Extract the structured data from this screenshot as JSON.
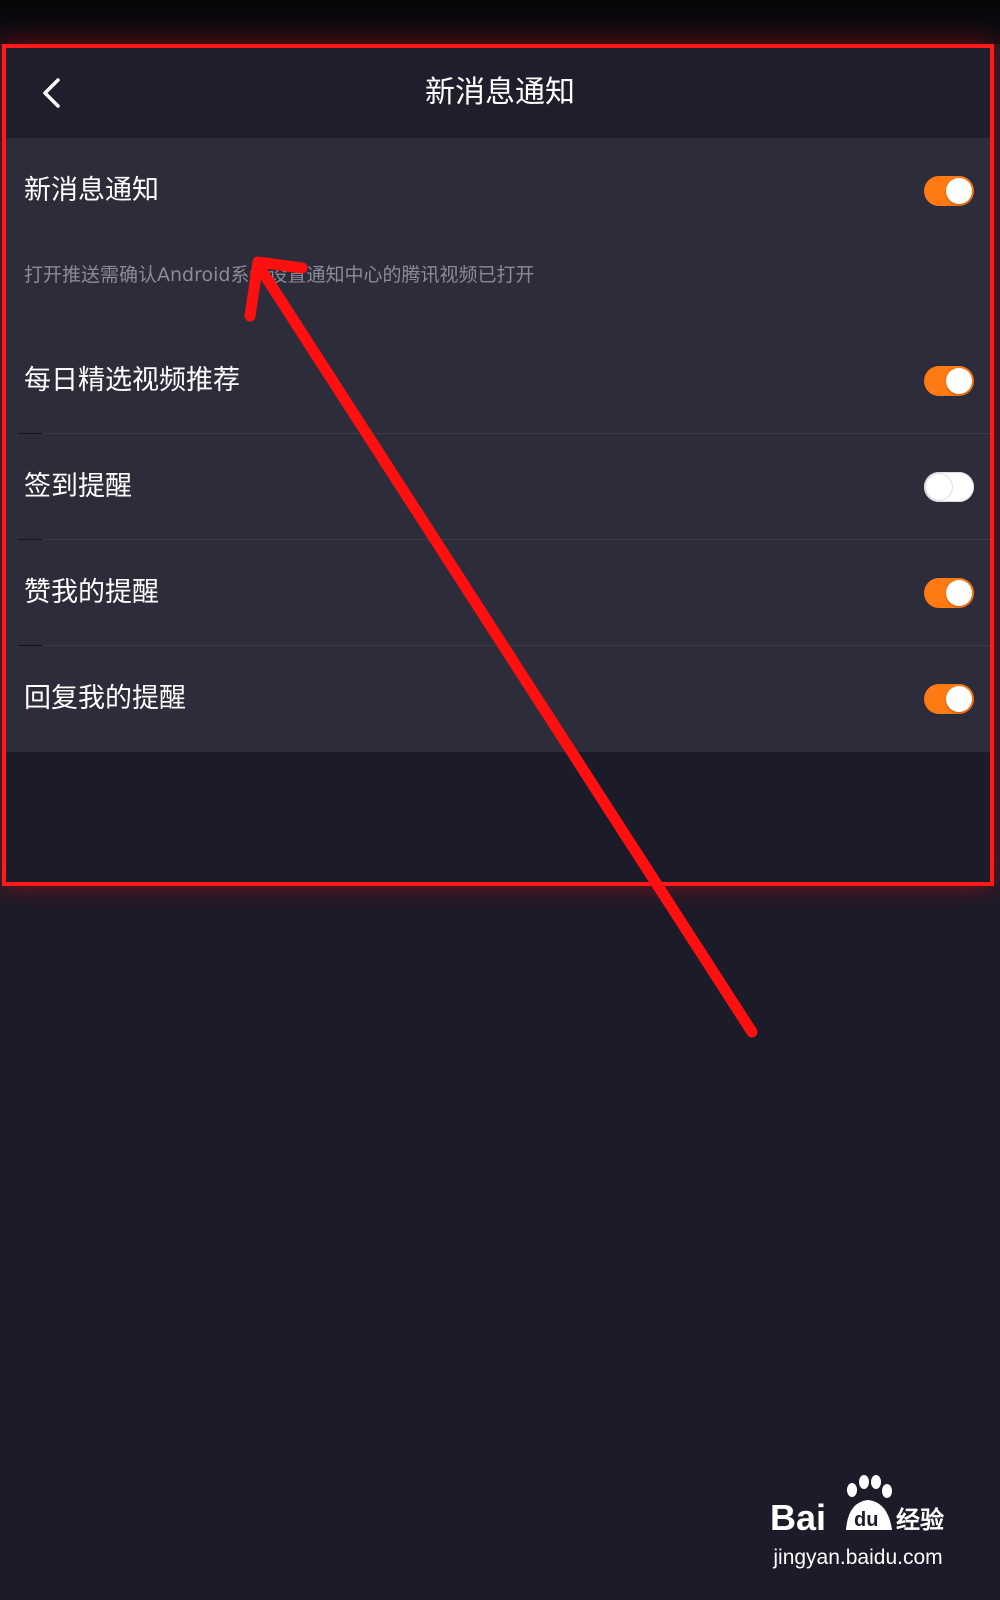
{
  "header": {
    "title": "新消息通知",
    "back_icon": "chevron-left-icon"
  },
  "settings": {
    "master": {
      "label": "新消息通知",
      "enabled": true,
      "description": "打开推送需确认Android系统设置通知中心的腾讯视频已打开"
    },
    "items": [
      {
        "label": "每日精选视频推荐",
        "enabled": true
      },
      {
        "label": "签到提醒",
        "enabled": false
      },
      {
        "label": "赞我的提醒",
        "enabled": true
      },
      {
        "label": "回复我的提醒",
        "enabled": true
      }
    ]
  },
  "colors": {
    "toggle_on": "#ff7a12",
    "background": "#1b1b29",
    "card": "#2c2c3a",
    "annotation": "#ff1a1a"
  },
  "watermark": {
    "logo_text": "Bai 经验",
    "url": "jingyan.baidu.com"
  }
}
